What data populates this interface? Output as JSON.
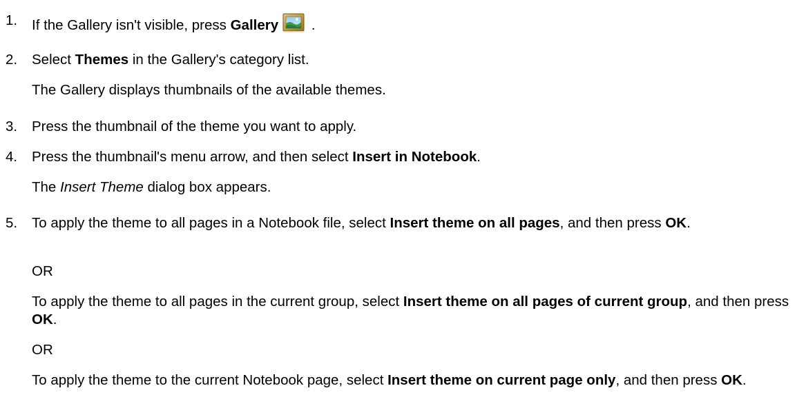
{
  "steps": [
    {
      "number": "1.",
      "pre": "If the Gallery isn't visible, press ",
      "bold": "Gallery",
      "post": " .",
      "icon": "gallery-icon"
    },
    {
      "number": "2.",
      "pre": "Select ",
      "bold": "Themes",
      "post": " in the Gallery's category list.",
      "note": "The Gallery displays thumbnails of the available themes."
    },
    {
      "number": "3.",
      "text": "Press the thumbnail of the theme you want to apply."
    },
    {
      "number": "4.",
      "pre": "Press the thumbnail's menu arrow, and then select ",
      "bold": "Insert in Notebook",
      "post": ".",
      "note_italic": "Insert Theme",
      "note_post": " dialog box appears.",
      "note_pre": "The "
    },
    {
      "number": "5.",
      "opt1_pre": "To apply the theme to all pages in a Notebook file, select ",
      "opt1_bold": "Insert theme on all pages",
      "opt1_mid": ", and then press ",
      "opt1_ok": "OK",
      "opt1_end": ".",
      "or1": "OR",
      "opt2_pre": "To apply the theme to all pages in the current group, select ",
      "opt2_bold": "Insert theme on all pages of current group",
      "opt2_mid": ", and then press ",
      "opt2_ok": "OK",
      "opt2_end": ".",
      "or2": "OR",
      "opt3_pre": "To apply the theme to the current Notebook page, select ",
      "opt3_bold": "Insert theme on current page only",
      "opt3_mid": ", and then press ",
      "opt3_ok": "OK",
      "opt3_end": "."
    }
  ]
}
